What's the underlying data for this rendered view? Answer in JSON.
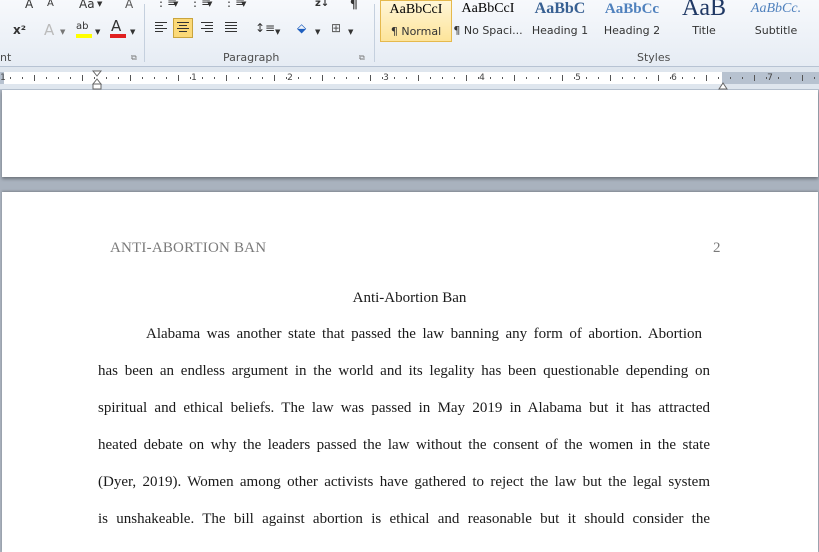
{
  "ribbon": {
    "font_group": {
      "label": "nt",
      "grow_font": "A",
      "shrink_font": "A",
      "change_case": "Aa",
      "subscript": "x",
      "superscript": "x²",
      "clear_formatting": "A",
      "highlight": "ab",
      "font_color": "A",
      "colors": {
        "highlight": "#ffff00",
        "font_color": "#e02020"
      }
    },
    "paragraph_group": {
      "label": "Paragraph",
      "sort": "z↓",
      "show_marks": "¶"
    },
    "styles_group": {
      "label": "Styles",
      "styles": [
        {
          "sample": "AaBbCcI",
          "name": "¶ Normal",
          "active": true
        },
        {
          "sample": "AaBbCcI",
          "name": "¶ No Spaci..."
        },
        {
          "sample": "AaBbC",
          "name": "Heading 1"
        },
        {
          "sample": "AaBbCc",
          "name": "Heading 2"
        },
        {
          "sample": "AaB",
          "name": "Title"
        },
        {
          "sample": "AaBbCc.",
          "name": "Subtitle"
        }
      ]
    }
  },
  "ruler": {
    "numbers": [
      "1",
      "1",
      "2",
      "3",
      "4",
      "5",
      "6",
      "7"
    ]
  },
  "document": {
    "header": "ANTI-ABORTION BAN",
    "page_number": "2",
    "title": "Anti-Abortion Ban",
    "lines": [
      "Alabama was another state that passed the law banning any form of abortion. Abortion",
      "has been an endless argument in the world and its legality has been questionable depending on",
      "spiritual and ethical beliefs. The law was passed in May 2019 in Alabama but it has attracted",
      "heated debate on why the leaders passed the law without the consent of the women in the state",
      "(Dyer, 2019). Women among other activists have gathered to reject the law but the legal system",
      "is unshakeable. The bill against abortion is ethical and reasonable but it should consider the"
    ]
  }
}
